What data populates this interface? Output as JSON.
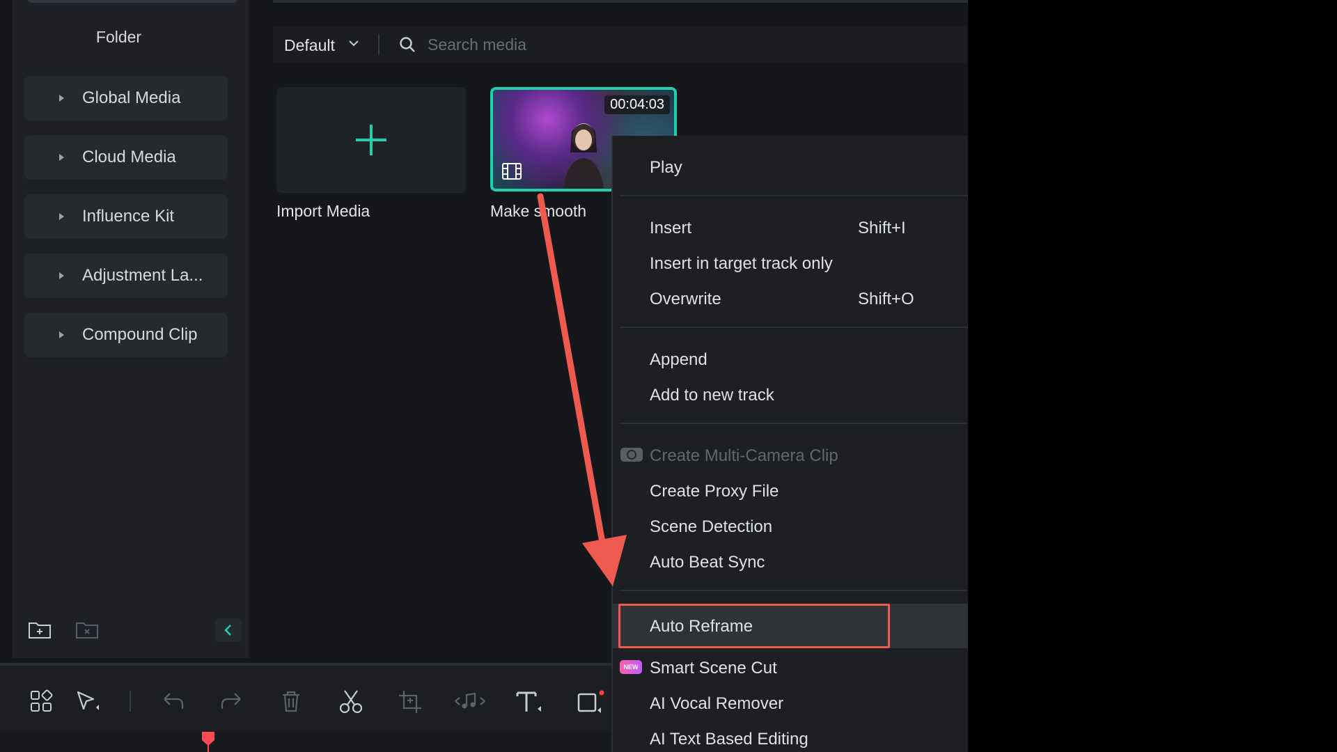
{
  "sidebar": {
    "title": "Folder",
    "items": [
      {
        "label": "Global Media"
      },
      {
        "label": "Cloud Media"
      },
      {
        "label": "Influence Kit"
      },
      {
        "label": "Adjustment La..."
      },
      {
        "label": "Compound Clip"
      }
    ]
  },
  "media": {
    "sort_label": "Default",
    "search_placeholder": "Search media",
    "import_label": "Import Media",
    "clip": {
      "duration": "00:04:03",
      "label": "Make smooth"
    }
  },
  "context_menu": {
    "items": [
      {
        "label": "Play"
      },
      {
        "label": "Insert",
        "shortcut": "Shift+I"
      },
      {
        "label": "Insert in target track only"
      },
      {
        "label": "Overwrite",
        "shortcut": "Shift+O"
      },
      {
        "label": "Append"
      },
      {
        "label": "Add to new track"
      },
      {
        "label": "Create Multi-Camera Clip",
        "disabled": true
      },
      {
        "label": "Create Proxy File"
      },
      {
        "label": "Scene Detection"
      },
      {
        "label": "Auto Beat Sync"
      },
      {
        "label": "Auto Reframe",
        "highlighted": true
      },
      {
        "label": "Smart Scene Cut",
        "badge": "NEW"
      },
      {
        "label": "AI Vocal Remover"
      },
      {
        "label": "AI Text Based Editing"
      }
    ]
  },
  "colors": {
    "accent": "#1fd0ac",
    "annotation": "#ee5a50",
    "menu_bg": "#1d1f23"
  }
}
